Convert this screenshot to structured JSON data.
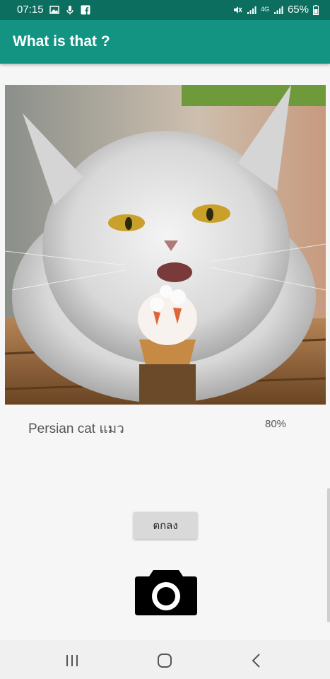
{
  "status_bar": {
    "time": "07:15",
    "battery": "65%",
    "network": "4G",
    "icons": [
      "gallery-icon",
      "mic-icon",
      "facebook-icon",
      "mute-icon",
      "signal-icon",
      "signal-icon",
      "battery-icon"
    ]
  },
  "app_bar": {
    "title": "What is that ?"
  },
  "photo": {
    "alt": "cat-with-ice-cream-photo"
  },
  "result": {
    "label": "Persian cat แมว",
    "confidence": "80%"
  },
  "actions": {
    "ok_label": "ตกลง",
    "camera_icon": "camera-icon"
  },
  "nav_bar": {
    "icons": [
      "recent-apps-icon",
      "home-icon",
      "back-icon"
    ]
  },
  "colors": {
    "status_bar": "#0b6e5f",
    "app_bar": "#139382",
    "background": "#f6f6f6"
  }
}
